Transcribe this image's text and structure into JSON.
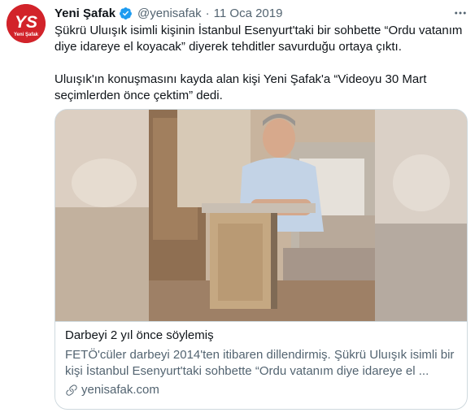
{
  "author": {
    "name": "Yeni Şafak",
    "handle": "@yenisafak",
    "separator": "·",
    "date": "11 Oca 2019",
    "avatar_logo_text": "YS",
    "avatar_sub_text": "Yeni Şafak",
    "avatar_color": "#d2232a"
  },
  "tweet": {
    "paragraph_1": "Şükrü Uluışık isimli kişinin İstanbul Esenyurt'taki bir sohbette “Ordu vatanım diye idareye el koyacak” diyerek tehditler savurduğu ortaya çıktı.",
    "paragraph_2": "Uluışık'ın konuşmasını kayda alan kişi Yeni Şafak'a “Videoyu 30 Mart seçimlerden önce çektim” dedi."
  },
  "card": {
    "title": "Darbeyi 2 yıl önce söylemiş",
    "description": "FETÖ'cüler darbeyi 2014'ten itibaren dillendirmiş. Şükrü Uluışık isimli bir kişi İstanbul Esenyurt'taki sohbette “Ordu vatanım diye idareye el ...",
    "domain": "yenisafak.com"
  },
  "colors": {
    "text_primary": "#0f1419",
    "text_secondary": "#536471",
    "border": "#cfd9de",
    "verified_blue": "#1d9bf0"
  },
  "icons": {
    "verified": "verified-badge-icon",
    "more": "more-options-icon",
    "link": "link-icon"
  }
}
